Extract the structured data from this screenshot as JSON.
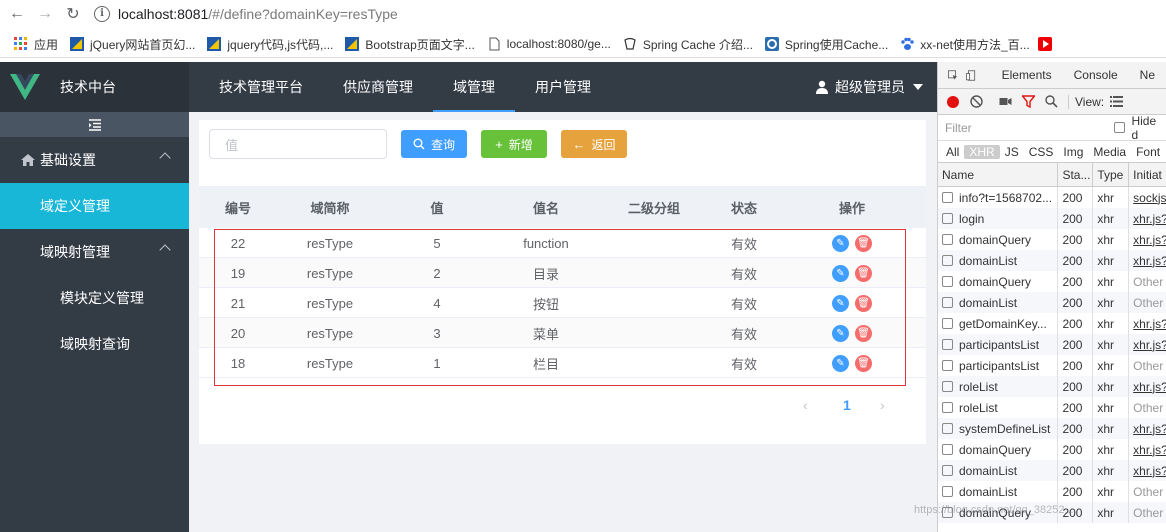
{
  "browser": {
    "url_host": "localhost:8081",
    "url_path": "/#/define?domainKey=resType",
    "bookmarks": [
      "应用",
      "jQuery网站首页幻...",
      "jquery代码,js代码,...",
      "Bootstrap页面文字...",
      "localhost:8080/ge...",
      "Spring Cache 介绍...",
      "Spring使用Cache...",
      "xx-net使用方法_百..."
    ]
  },
  "sidebar": {
    "title": "技术中台",
    "menu": [
      {
        "label": "基础设置",
        "level": 1,
        "active": false
      },
      {
        "label": "域定义管理",
        "level": 2,
        "active": true
      },
      {
        "label": "域映射管理",
        "level": 2,
        "active": false
      },
      {
        "label": "模块定义管理",
        "level": 3,
        "active": false
      },
      {
        "label": "域映射查询",
        "level": 3,
        "active": false
      }
    ]
  },
  "topnav": {
    "items": [
      "技术管理平台",
      "供应商管理",
      "域管理",
      "用户管理"
    ],
    "active": "域管理",
    "user": "超级管理员"
  },
  "toolbar": {
    "search_placeholder": "值",
    "query_label": "查询",
    "add_label": "新增",
    "back_label": "返回"
  },
  "table": {
    "columns": [
      "编号",
      "域简称",
      "值",
      "值名",
      "二级分组",
      "状态",
      "操作"
    ],
    "rows": [
      {
        "id": "22",
        "domain": "resType",
        "value": "5",
        "name": "function",
        "group": "",
        "status": "有效"
      },
      {
        "id": "19",
        "domain": "resType",
        "value": "2",
        "name": "目录",
        "group": "",
        "status": "有效"
      },
      {
        "id": "21",
        "domain": "resType",
        "value": "4",
        "name": "按钮",
        "group": "",
        "status": "有效"
      },
      {
        "id": "20",
        "domain": "resType",
        "value": "3",
        "name": "菜单",
        "group": "",
        "status": "有效"
      },
      {
        "id": "18",
        "domain": "resType",
        "value": "1",
        "name": "栏目",
        "group": "",
        "status": "有效"
      }
    ]
  },
  "pagination": {
    "current": "1"
  },
  "devtools": {
    "tabs": [
      "Elements",
      "Console",
      "Ne"
    ],
    "view_label": "View:",
    "filter_placeholder": "Filter",
    "hide_label": "Hide d",
    "types": [
      "All",
      "XHR",
      "JS",
      "CSS",
      "Img",
      "Media",
      "Font"
    ],
    "selected_type": "XHR",
    "columns": [
      "Name",
      "Sta...",
      "Type",
      "Initiat"
    ],
    "requests": [
      {
        "name": "info?t=1568702...",
        "status": "200",
        "type": "xhr",
        "initiator": "sockjs",
        "link": true
      },
      {
        "name": "login",
        "status": "200",
        "type": "xhr",
        "initiator": "xhr.js?",
        "link": true
      },
      {
        "name": "domainQuery",
        "status": "200",
        "type": "xhr",
        "initiator": "xhr.js?",
        "link": true
      },
      {
        "name": "domainList",
        "status": "200",
        "type": "xhr",
        "initiator": "xhr.js?",
        "link": true
      },
      {
        "name": "domainQuery",
        "status": "200",
        "type": "xhr",
        "initiator": "Other",
        "link": false
      },
      {
        "name": "domainList",
        "status": "200",
        "type": "xhr",
        "initiator": "Other",
        "link": false
      },
      {
        "name": "getDomainKey...",
        "status": "200",
        "type": "xhr",
        "initiator": "xhr.js?",
        "link": true
      },
      {
        "name": "participantsList",
        "status": "200",
        "type": "xhr",
        "initiator": "xhr.js?",
        "link": true
      },
      {
        "name": "participantsList",
        "status": "200",
        "type": "xhr",
        "initiator": "Other",
        "link": false
      },
      {
        "name": "roleList",
        "status": "200",
        "type": "xhr",
        "initiator": "xhr.js?",
        "link": true
      },
      {
        "name": "roleList",
        "status": "200",
        "type": "xhr",
        "initiator": "Other",
        "link": false
      },
      {
        "name": "systemDefineList",
        "status": "200",
        "type": "xhr",
        "initiator": "xhr.js?",
        "link": true
      },
      {
        "name": "domainQuery",
        "status": "200",
        "type": "xhr",
        "initiator": "xhr.js?",
        "link": true
      },
      {
        "name": "domainList",
        "status": "200",
        "type": "xhr",
        "initiator": "xhr.js?",
        "link": true
      },
      {
        "name": "domainList",
        "status": "200",
        "type": "xhr",
        "initiator": "Other",
        "link": false
      },
      {
        "name": "domainQuery",
        "status": "200",
        "type": "xhr",
        "initiator": "Other",
        "link": false
      }
    ]
  },
  "watermark": "https://blog.csdn.net/qq_38252..."
}
